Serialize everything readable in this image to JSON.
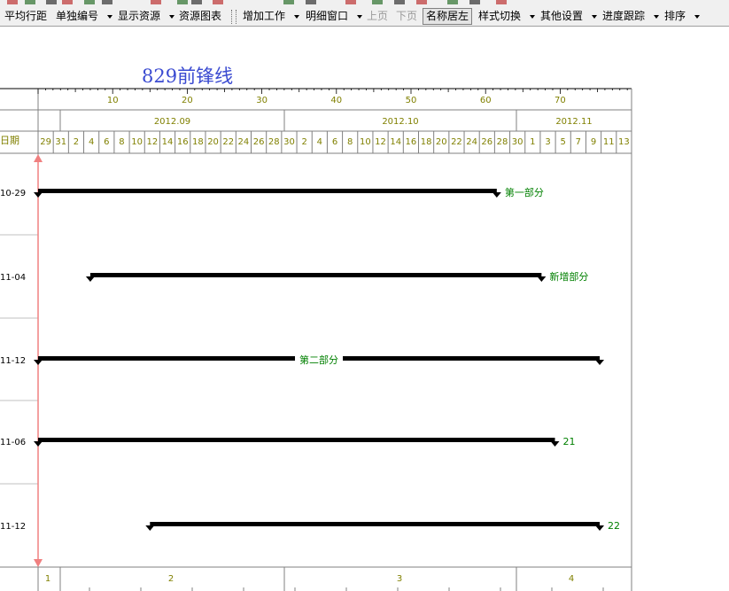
{
  "toolbar": {
    "items": [
      {
        "label": "平均行距",
        "dropdown": false,
        "enabled": true
      },
      {
        "label": "单独编号",
        "dropdown": true,
        "enabled": true
      },
      {
        "label": "显示资源",
        "dropdown": true,
        "enabled": true
      },
      {
        "label": "资源图表",
        "dropdown": false,
        "enabled": true
      },
      {
        "label": "增加工作",
        "dropdown": true,
        "enabled": true
      },
      {
        "label": "明细窗口",
        "dropdown": true,
        "enabled": true
      },
      {
        "label": "上页",
        "dropdown": false,
        "enabled": false
      },
      {
        "label": "下页",
        "dropdown": false,
        "enabled": false
      },
      {
        "label": "名称居左",
        "dropdown": false,
        "enabled": true,
        "pressed": true
      },
      {
        "label": "样式切换",
        "dropdown": true,
        "enabled": true
      },
      {
        "label": "其他设置",
        "dropdown": true,
        "enabled": true
      },
      {
        "label": "进度跟踪",
        "dropdown": true,
        "enabled": true
      },
      {
        "label": "排序",
        "dropdown": true,
        "enabled": true
      }
    ]
  },
  "chart_title": "829前锋线",
  "ruler": {
    "labels": [
      "10",
      "20",
      "30",
      "40",
      "50",
      "60",
      "70"
    ]
  },
  "months": [
    "2012.09",
    "2012.10",
    "2012.11"
  ],
  "date_header_label": "日期",
  "days": [
    "29",
    "31",
    "2",
    "4",
    "6",
    "8",
    "10",
    "12",
    "14",
    "16",
    "18",
    "20",
    "22",
    "24",
    "26",
    "28",
    "30",
    "2",
    "4",
    "6",
    "8",
    "10",
    "12",
    "14",
    "16",
    "18",
    "20",
    "22",
    "24",
    "26",
    "28",
    "30",
    "1",
    "3",
    "5",
    "7",
    "9",
    "11",
    "13"
  ],
  "rows": [
    {
      "date": "10-29",
      "label": "第一部分"
    },
    {
      "date": "11-04",
      "label": "新增部分"
    },
    {
      "date": "11-12",
      "label": "第二部分"
    },
    {
      "date": "11-06",
      "label": "21"
    },
    {
      "date": "11-12",
      "label": "22"
    }
  ],
  "footer": {
    "labels": [
      "1",
      "2",
      "3",
      "4"
    ]
  },
  "colors": {
    "title": "#3b4bd1",
    "label_green": "#008000",
    "ruler_text": "#808000",
    "frontline": "#f08080",
    "bar": "#000000",
    "grid": "#808080"
  }
}
